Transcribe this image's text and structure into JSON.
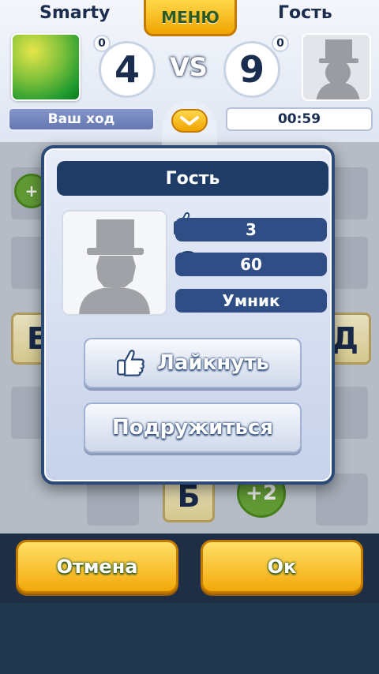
{
  "header": {
    "left_player": "Smarty",
    "right_player": "Гость",
    "menu_label": "МЕНЮ",
    "left_score": "4",
    "right_score": "9",
    "left_small_score": "0",
    "right_small_score": "0",
    "vs_label": "VS",
    "turn_label": "Ваш ход",
    "timer": "00:59"
  },
  "board": {
    "tiles": [
      "Е",
      "Д",
      "Б"
    ],
    "bonuses": [
      "+",
      "+2"
    ]
  },
  "modal": {
    "title": "Гость",
    "likes": "3",
    "points": "60",
    "rank": "Умник",
    "like_button": "Лайкнуть",
    "friend_button": "Подружиться"
  },
  "buttons": {
    "cancel": "Отмена",
    "ok": "Ок"
  },
  "colors": {
    "accent_yellow": "#f3a80a",
    "navy": "#1f3c66"
  }
}
